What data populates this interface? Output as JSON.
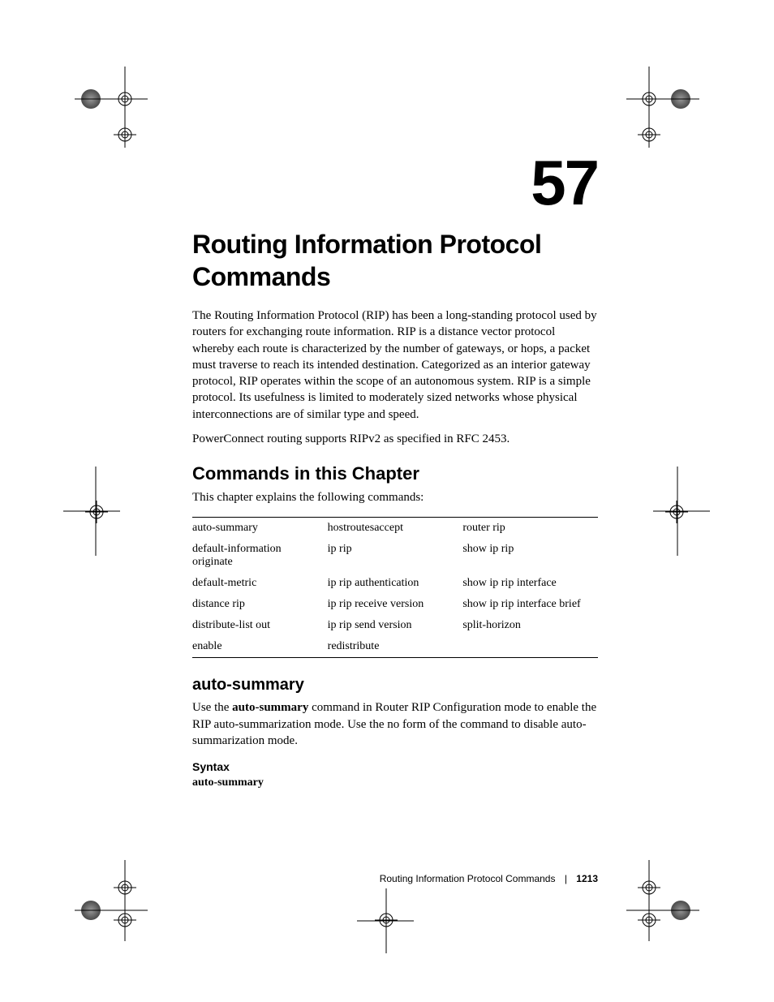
{
  "chapter_number": "57",
  "title": "Routing Information Protocol Commands",
  "intro_p1": "The Routing Information Protocol (RIP) has been a long-standing protocol used by routers for exchanging route information. RIP is a distance vector protocol whereby each route is characterized by the number of gateways, or hops, a packet must traverse to reach its intended destination. Categorized as an interior gateway protocol, RIP operates within the scope of an autonomous system. RIP is a simple protocol. Its usefulness is limited to moderately sized networks whose physical interconnections are of similar type and speed.",
  "intro_p2": "PowerConnect routing supports RIPv2 as specified in RFC 2453.",
  "section_commands_heading": "Commands in this Chapter",
  "section_commands_intro": "This chapter explains the following commands:",
  "commands_table": {
    "rows": [
      [
        "auto-summary",
        "hostroutesaccept",
        "router rip"
      ],
      [
        "default-information originate",
        "ip rip",
        "show ip rip"
      ],
      [
        "default-metric",
        "ip rip authentication",
        "show ip rip interface"
      ],
      [
        "distance rip",
        "ip rip receive version",
        "show ip rip interface brief"
      ],
      [
        "distribute-list out",
        "ip rip send version",
        "split-horizon"
      ],
      [
        "enable",
        "redistribute",
        ""
      ]
    ]
  },
  "section_auto_summary": {
    "heading": "auto-summary",
    "body": "Use the auto-summary command in Router RIP Configuration mode to enable the RIP auto-summarization mode. Use the no form of the command to disable auto-summarization mode.",
    "body_pre": "Use the ",
    "body_bold": "auto-summary",
    "body_post": " command in Router RIP Configuration mode to enable the RIP auto-summarization mode. Use the no form of the command to disable auto-summarization mode.",
    "syntax_label": "Syntax",
    "syntax_cmd": "auto-summary"
  },
  "footer": {
    "title": "Routing Information Protocol Commands",
    "page": "1213"
  }
}
